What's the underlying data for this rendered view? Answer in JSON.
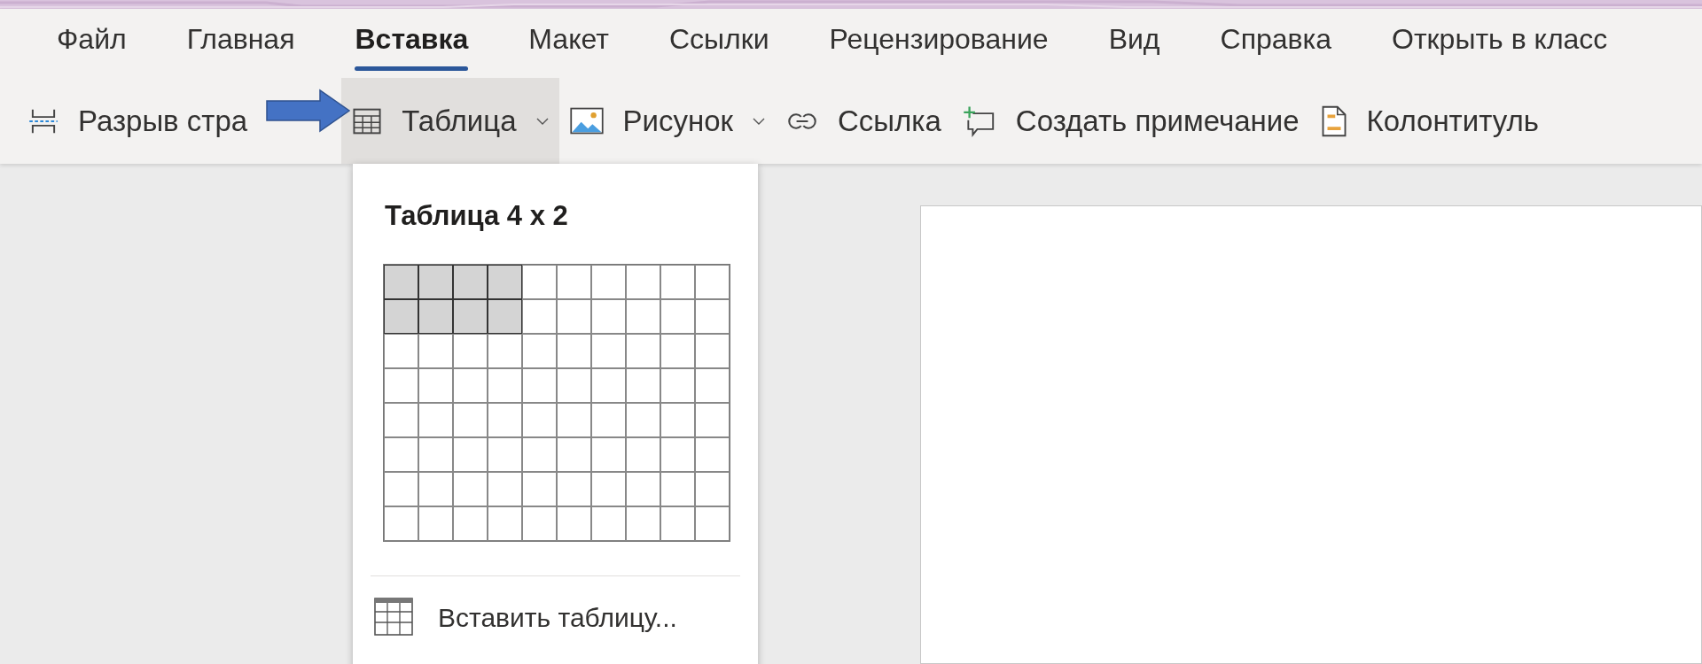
{
  "tabs": [
    {
      "label": "Файл",
      "selected": false
    },
    {
      "label": "Главная",
      "selected": false
    },
    {
      "label": "Вставка",
      "selected": true
    },
    {
      "label": "Макет",
      "selected": false
    },
    {
      "label": "Ссылки",
      "selected": false
    },
    {
      "label": "Рецензирование",
      "selected": false
    },
    {
      "label": "Вид",
      "selected": false
    },
    {
      "label": "Справка",
      "selected": false
    },
    {
      "label": "Открыть в класс",
      "selected": false
    }
  ],
  "toolbar": [
    {
      "kind": "page-break",
      "label": "Разрыв стра",
      "dropdown": false,
      "selected": false
    },
    {
      "kind": "table",
      "label": "Таблица",
      "dropdown": true,
      "selected": true
    },
    {
      "kind": "picture",
      "label": "Рисунок",
      "dropdown": true,
      "selected": false
    },
    {
      "kind": "link",
      "label": "Ссылка",
      "dropdown": false,
      "selected": false
    },
    {
      "kind": "comment",
      "label": "Создать примечание",
      "dropdown": false,
      "selected": false
    },
    {
      "kind": "header-footer",
      "label": "Колонтитуль",
      "dropdown": false,
      "selected": false
    }
  ],
  "table_menu": {
    "title": "Таблица 4 x 2",
    "grid": [
      {
        "cells": [
          {
            "selected": true
          },
          {
            "selected": true
          },
          {
            "selected": true
          },
          {
            "selected": true
          },
          {
            "selected": false
          },
          {
            "selected": false
          },
          {
            "selected": false
          },
          {
            "selected": false
          },
          {
            "selected": false
          },
          {
            "selected": false
          }
        ]
      },
      {
        "cells": [
          {
            "selected": true
          },
          {
            "selected": true
          },
          {
            "selected": true
          },
          {
            "selected": true
          },
          {
            "selected": false
          },
          {
            "selected": false
          },
          {
            "selected": false
          },
          {
            "selected": false
          },
          {
            "selected": false
          },
          {
            "selected": false
          }
        ]
      },
      {
        "cells": [
          {
            "selected": false
          },
          {
            "selected": false
          },
          {
            "selected": false
          },
          {
            "selected": false
          },
          {
            "selected": false
          },
          {
            "selected": false
          },
          {
            "selected": false
          },
          {
            "selected": false
          },
          {
            "selected": false
          },
          {
            "selected": false
          }
        ]
      },
      {
        "cells": [
          {
            "selected": false
          },
          {
            "selected": false
          },
          {
            "selected": false
          },
          {
            "selected": false
          },
          {
            "selected": false
          },
          {
            "selected": false
          },
          {
            "selected": false
          },
          {
            "selected": false
          },
          {
            "selected": false
          },
          {
            "selected": false
          }
        ]
      },
      {
        "cells": [
          {
            "selected": false
          },
          {
            "selected": false
          },
          {
            "selected": false
          },
          {
            "selected": false
          },
          {
            "selected": false
          },
          {
            "selected": false
          },
          {
            "selected": false
          },
          {
            "selected": false
          },
          {
            "selected": false
          },
          {
            "selected": false
          }
        ]
      },
      {
        "cells": [
          {
            "selected": false
          },
          {
            "selected": false
          },
          {
            "selected": false
          },
          {
            "selected": false
          },
          {
            "selected": false
          },
          {
            "selected": false
          },
          {
            "selected": false
          },
          {
            "selected": false
          },
          {
            "selected": false
          },
          {
            "selected": false
          }
        ]
      },
      {
        "cells": [
          {
            "selected": false
          },
          {
            "selected": false
          },
          {
            "selected": false
          },
          {
            "selected": false
          },
          {
            "selected": false
          },
          {
            "selected": false
          },
          {
            "selected": false
          },
          {
            "selected": false
          },
          {
            "selected": false
          },
          {
            "selected": false
          }
        ]
      },
      {
        "cells": [
          {
            "selected": false
          },
          {
            "selected": false
          },
          {
            "selected": false
          },
          {
            "selected": false
          },
          {
            "selected": false
          },
          {
            "selected": false
          },
          {
            "selected": false
          },
          {
            "selected": false
          },
          {
            "selected": false
          },
          {
            "selected": false
          }
        ]
      }
    ],
    "insert_item": "Вставить таблицу..."
  }
}
